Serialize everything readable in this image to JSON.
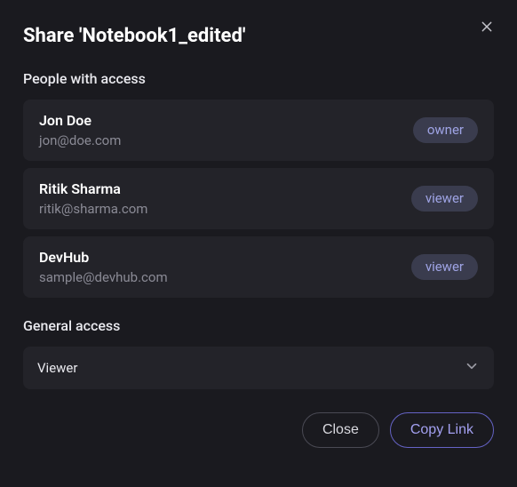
{
  "dialog": {
    "title": "Share 'Notebook1_edited'",
    "close_icon": "close"
  },
  "people": {
    "section_label": "People with access",
    "items": [
      {
        "name": "Jon Doe",
        "email": "jon@doe.com",
        "role": "owner"
      },
      {
        "name": "Ritik Sharma",
        "email": "ritik@sharma.com",
        "role": "viewer"
      },
      {
        "name": "DevHub",
        "email": "sample@devhub.com",
        "role": "viewer"
      }
    ]
  },
  "general": {
    "section_label": "General access",
    "selected": "Viewer"
  },
  "footer": {
    "close_label": "Close",
    "copy_label": "Copy Link"
  }
}
